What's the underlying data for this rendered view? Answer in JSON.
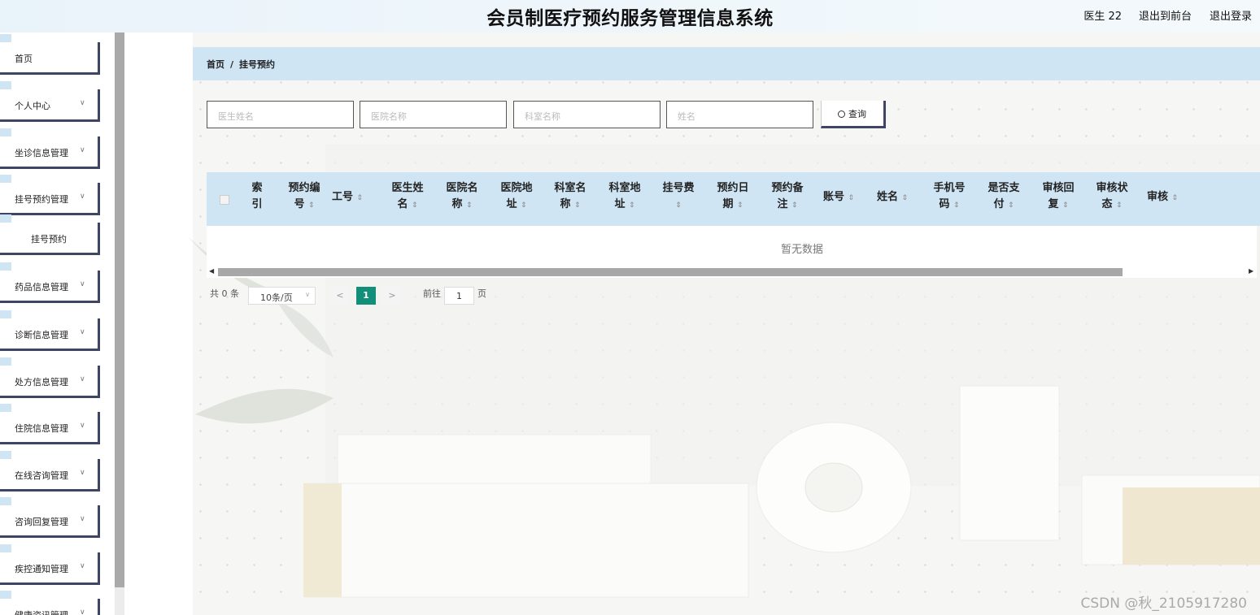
{
  "header": {
    "title": "会员制医疗预约服务管理信息系统",
    "user": "医生 22",
    "front_link": "退出到前台",
    "logout_link": "退出登录"
  },
  "sidebar": {
    "items": [
      {
        "label": "首页",
        "has_chevron": false
      },
      {
        "label": "个人中心",
        "has_chevron": true
      },
      {
        "label": "坐诊信息管理",
        "has_chevron": true
      },
      {
        "label": "挂号预约管理",
        "has_chevron": true
      },
      {
        "label": "挂号预约",
        "has_chevron": false,
        "sub": true
      },
      {
        "label": "药品信息管理",
        "has_chevron": true
      },
      {
        "label": "诊断信息管理",
        "has_chevron": true
      },
      {
        "label": "处方信息管理",
        "has_chevron": true
      },
      {
        "label": "住院信息管理",
        "has_chevron": true
      },
      {
        "label": "在线咨询管理",
        "has_chevron": true
      },
      {
        "label": "咨询回复管理",
        "has_chevron": true
      },
      {
        "label": "疾控通知管理",
        "has_chevron": true
      },
      {
        "label": "健康资讯管理",
        "has_chevron": true
      }
    ],
    "chevron": "∨"
  },
  "breadcrumb": {
    "home": "首页",
    "separator": "/",
    "current": "挂号预约"
  },
  "search": {
    "doctor_name_placeholder": "医生姓名",
    "hospital_name_placeholder": "医院名称",
    "department_name_placeholder": "科室名称",
    "name_placeholder": "姓名",
    "button_label": "查询",
    "button_icon": "search-icon"
  },
  "table": {
    "columns": [
      {
        "line1": "索",
        "line2": "引",
        "sortable": false
      },
      {
        "line1": "预约编",
        "line2": "号",
        "sortable": true
      },
      {
        "line1": "工号",
        "line2": "",
        "sortable": true
      },
      {
        "line1": "医生姓",
        "line2": "名",
        "sortable": true
      },
      {
        "line1": "医院名",
        "line2": "称",
        "sortable": true
      },
      {
        "line1": "医院地",
        "line2": "址",
        "sortable": true
      },
      {
        "line1": "科室名",
        "line2": "称",
        "sortable": true
      },
      {
        "line1": "科室地",
        "line2": "址",
        "sortable": true
      },
      {
        "line1": "挂号费",
        "line2": "",
        "sortable": true,
        "sort_below": true
      },
      {
        "line1": "预约日",
        "line2": "期",
        "sortable": true
      },
      {
        "line1": "预约备",
        "line2": "注",
        "sortable": true
      },
      {
        "line1": "账号",
        "line2": "",
        "sortable": true
      },
      {
        "line1": "姓名",
        "line2": "",
        "sortable": true
      },
      {
        "line1": "手机号",
        "line2": "码",
        "sortable": true
      },
      {
        "line1": "是否支",
        "line2": "付",
        "sortable": true
      },
      {
        "line1": "审核回",
        "line2": "复",
        "sortable": true
      },
      {
        "line1": "审核状",
        "line2": "态",
        "sortable": true
      },
      {
        "line1": "审核",
        "line2": "",
        "sortable": true
      }
    ],
    "sort_icon": "⇕",
    "empty_text": "暂无数据"
  },
  "pagination": {
    "total": "共 0 条",
    "page_size": "10条/页",
    "prev": "<",
    "current_page": "1",
    "next": ">",
    "goto_label": "前往",
    "goto_value": "1",
    "page_suffix": "页"
  },
  "watermark": "CSDN @秋_2105917280"
}
